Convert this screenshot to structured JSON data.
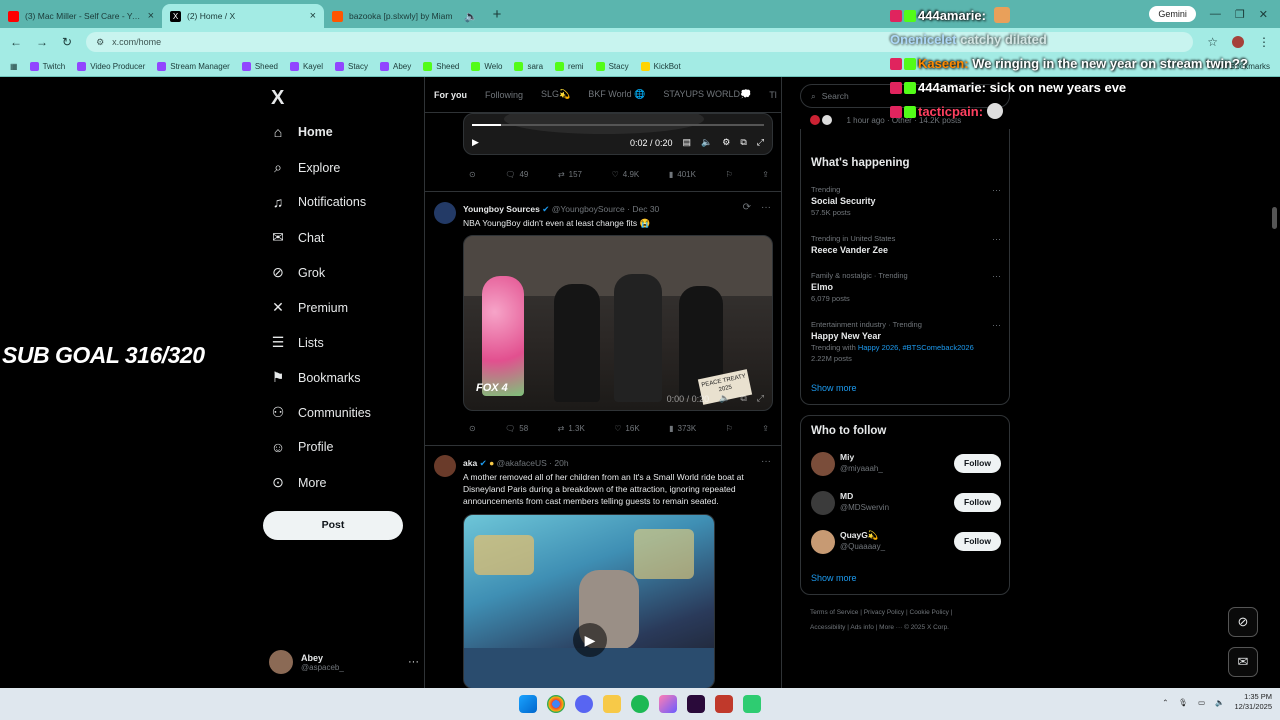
{
  "browser": {
    "tabs": [
      {
        "title": "(3) Mac Miller - Self Care - YouT",
        "favicon_color": "#ff0000"
      },
      {
        "title": "(2) Home / X",
        "favicon_color": "#000000"
      },
      {
        "title": "bazooka [p.slxwly] by Miam",
        "favicon_color": "#ff5500"
      }
    ],
    "new_tab": "+",
    "gemini_label": "Gemini",
    "url": "x.com/home",
    "bookmarks": [
      {
        "label": "Twitch",
        "color": "#9146ff"
      },
      {
        "label": "Video Producer",
        "color": "#9146ff"
      },
      {
        "label": "Stream Manager",
        "color": "#9146ff"
      },
      {
        "label": "Sheed",
        "color": "#9146ff"
      },
      {
        "label": "Kayel",
        "color": "#9146ff"
      },
      {
        "label": "Stacy",
        "color": "#9146ff"
      },
      {
        "label": "Abey",
        "color": "#9146ff"
      },
      {
        "label": "Sheed",
        "color": "#53fc18"
      },
      {
        "label": "Welo",
        "color": "#53fc18"
      },
      {
        "label": "sara",
        "color": "#53fc18"
      },
      {
        "label": "remi",
        "color": "#53fc18"
      },
      {
        "label": "Stacy",
        "color": "#53fc18"
      },
      {
        "label": "KickBot",
        "color": "#ffd400"
      }
    ],
    "all_bookmarks": "All Bookmarks"
  },
  "sidebar": {
    "logo": "X",
    "items": [
      {
        "label": "Home",
        "icon": "home-icon",
        "glyph": "⌂"
      },
      {
        "label": "Explore",
        "icon": "search-icon",
        "glyph": "⌕"
      },
      {
        "label": "Notifications",
        "icon": "bell-icon",
        "glyph": "🔔"
      },
      {
        "label": "Chat",
        "icon": "mail-icon",
        "glyph": "✉"
      },
      {
        "label": "Grok",
        "icon": "grok-icon",
        "glyph": "⊘"
      },
      {
        "label": "Premium",
        "icon": "x-icon",
        "glyph": "✕"
      },
      {
        "label": "Lists",
        "icon": "list-icon",
        "glyph": "☰"
      },
      {
        "label": "Bookmarks",
        "icon": "bookmark-icon",
        "glyph": "❐"
      },
      {
        "label": "Communities",
        "icon": "people-icon",
        "glyph": "⚇"
      },
      {
        "label": "Profile",
        "icon": "user-icon",
        "glyph": "☺"
      },
      {
        "label": "More",
        "icon": "more-icon",
        "glyph": "⋯"
      }
    ],
    "post_button": "Post",
    "account": {
      "name": "Abey",
      "handle": "@aspaceb_"
    }
  },
  "feed": {
    "tabs": [
      "For you",
      "Following",
      "SLG💫",
      "BKF World 🌐",
      "STAYUPS WORLD💭",
      "Tl"
    ],
    "top_video": {
      "time": "0:02 / 0:20",
      "stats": {
        "replies": "49",
        "reposts": "157",
        "likes": "4.9K",
        "views": "401K"
      }
    },
    "posts": [
      {
        "name": "Youngboy Sources",
        "handle": "@YoungboySource",
        "date": "· Dec 30",
        "text": "NBA YoungBoy didn't even at least change fits 😭",
        "video_time": "0:00 / 0:20",
        "watermark": "FOX 4",
        "sign": "PEACE TREATY 2025",
        "stats": {
          "replies": "58",
          "reposts": "1.3K",
          "likes": "16K",
          "views": "373K"
        }
      },
      {
        "name": "aka",
        "handle": "@akafaceUS",
        "date": "· 20h",
        "text": "A mother removed all of her children from an It's a Small World ride boat at Disneyland Paris during a breakdown of the attraction, ignoring repeated announcements from cast members telling guests to remain seated."
      }
    ]
  },
  "right": {
    "search_placeholder": "Search",
    "live_snippet": "1 hour ago · Other · 14.2K posts",
    "happening_title": "What's happening",
    "trends": [
      {
        "category": "Trending",
        "name": "Social Security",
        "count": "57.5K posts"
      },
      {
        "category": "Trending in United States",
        "name": "Reece Vander Zee",
        "count": ""
      },
      {
        "category": "Family & nostalgic · Trending",
        "name": "Elmo",
        "count": "6,079 posts"
      },
      {
        "category": "Entertainment industry · Trending",
        "name": "Happy New Year",
        "count": "2.22M posts",
        "with_prefix": "Trending with",
        "with_links": "Happy 2026, #BTSComeback2026"
      }
    ],
    "show_more": "Show more",
    "who_to_follow_title": "Who to follow",
    "follow": [
      {
        "name": "Miy",
        "handle": "@miyaaah_",
        "button": "Follow"
      },
      {
        "name": "MD",
        "handle": "@MDSwervin",
        "button": "Follow"
      },
      {
        "name": "QuayG💫",
        "handle": "@Quaaaay_",
        "button": "Follow"
      }
    ],
    "footer": [
      "Terms of Service",
      "Privacy Policy",
      "Cookie Policy",
      "Accessibility",
      "Ads info",
      "More ···",
      "© 2025 X Corp."
    ]
  },
  "overlay": {
    "sub_goal": "SUB GOAL 316/320",
    "chat": [
      {
        "user": "444amarie",
        "text": ""
      },
      {
        "user": "Onenicelet",
        "text": "catchy dilated"
      },
      {
        "user": "Kaseen",
        "text": "We ringing in the new year on stream twin??"
      },
      {
        "user": "444amarie",
        "text": "sick on new years eve"
      },
      {
        "user": "tacticpain",
        "text": ""
      }
    ]
  },
  "taskbar": {
    "time": "1:35 PM",
    "date": "12/31/2025"
  }
}
